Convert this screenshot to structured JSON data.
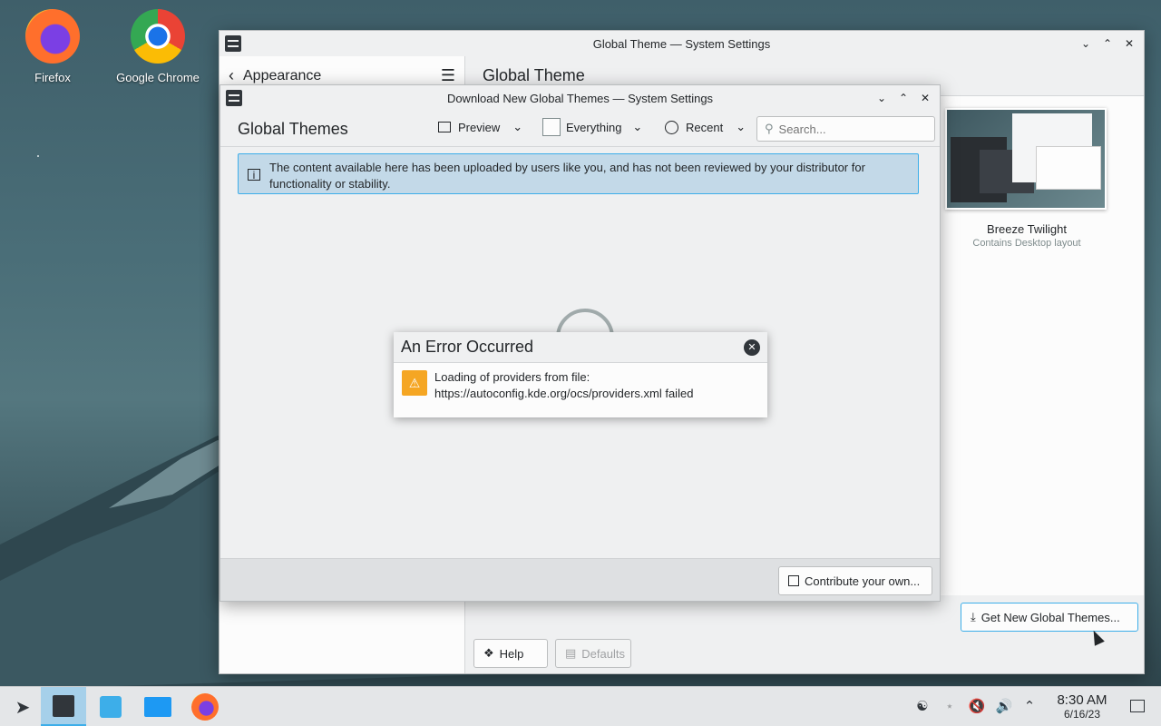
{
  "desktop": {
    "icons": [
      {
        "label": "Firefox"
      },
      {
        "label": "Google Chrome"
      }
    ]
  },
  "settings_window": {
    "title": "Global Theme — System Settings",
    "sidebar_title": "Appearance",
    "page_title": "Global Theme",
    "theme_card": {
      "name": "Breeze Twilight",
      "subtitle": "Contains Desktop layout"
    },
    "get_new_button": "Get New Global Themes...",
    "help_button": "Help",
    "defaults_button": "Defaults"
  },
  "download_dialog": {
    "title": "Download New Global Themes — System Settings",
    "header_title": "Global Themes",
    "preview_label": "Preview",
    "filter_label": "Everything",
    "sort_label": "Recent",
    "search_placeholder": "Search...",
    "info_message": "The content available here has been uploaded by users like you, and has not been reviewed by your distributor for functionality or stability.",
    "contribute_button": "Contribute your own..."
  },
  "error_popup": {
    "title": "An Error Occurred",
    "message": "Loading of providers from file: https://autoconfig.kde.org/ocs/providers.xml failed"
  },
  "taskbar": {
    "clock_time": "8:30 AM",
    "clock_date": "6/16/23"
  },
  "colors": {
    "accent": "#3daee9",
    "info_bg": "#c3d9e8",
    "warning": "#f5a623"
  }
}
